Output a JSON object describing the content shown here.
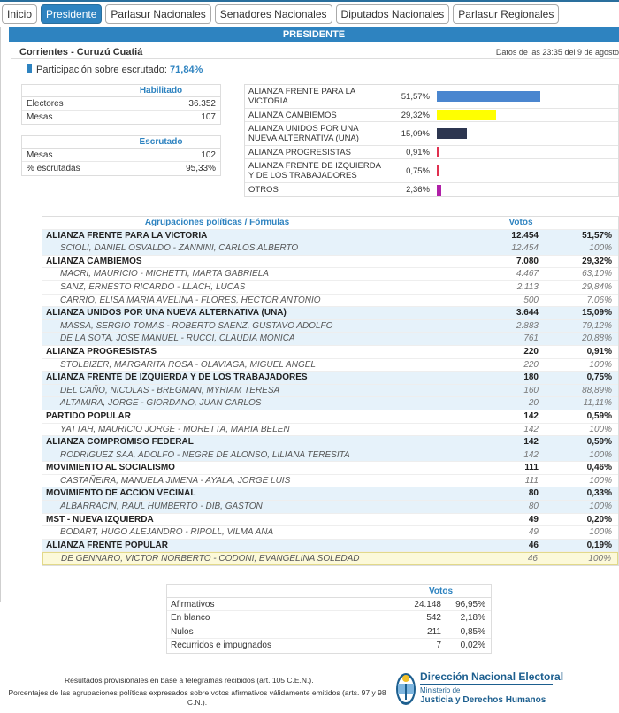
{
  "nav": {
    "tabs": [
      {
        "label": "Inicio",
        "active": false
      },
      {
        "label": "Presidente",
        "active": true
      },
      {
        "label": "Parlasur Nacionales",
        "active": false
      },
      {
        "label": "Senadores Nacionales",
        "active": false
      },
      {
        "label": "Diputados Nacionales",
        "active": false
      },
      {
        "label": "Parlasur Regionales",
        "active": false
      }
    ]
  },
  "section_title": "PRESIDENTE",
  "location": "Corrientes - Curuzú Cuatiá",
  "timestamp": "Datos de las 23:35 del 9 de agosto",
  "participacion": {
    "label": "Participación sobre escrutado:",
    "value": "71,84%"
  },
  "habilitado": {
    "title": "Habilitado",
    "rows": [
      {
        "label": "Electores",
        "value": "36.352"
      },
      {
        "label": "Mesas",
        "value": "107"
      }
    ]
  },
  "escrutado": {
    "title": "Escrutado",
    "rows": [
      {
        "label": "Mesas",
        "value": "102"
      },
      {
        "label": "% escrutadas",
        "value": "95,33%"
      }
    ]
  },
  "bar_chart": [
    {
      "name": "ALIANZA FRENTE PARA LA VICTORIA",
      "pct": "51,57%",
      "value": 51.57,
      "color": "#4a86cf"
    },
    {
      "name": "ALIANZA CAMBIEMOS",
      "pct": "29,32%",
      "value": 29.32,
      "color": "#ffff00"
    },
    {
      "name": "ALIANZA UNIDOS POR UNA NUEVA ALTERNATIVA (UNA)",
      "pct": "15,09%",
      "value": 15.09,
      "color": "#2d3650"
    },
    {
      "name": "ALIANZA PROGRESISTAS",
      "pct": "0,91%",
      "value": 0.91,
      "color": "#e0304f"
    },
    {
      "name": "ALIANZA FRENTE DE IZQUIERDA Y DE LOS TRABAJADORES",
      "pct": "0,75%",
      "value": 0.75,
      "color": "#e0304f"
    },
    {
      "name": "OTROS",
      "pct": "2,36%",
      "value": 2.36,
      "color": "#b020a8"
    }
  ],
  "table": {
    "header": {
      "col1": "Agrupaciones políticas / Fórmulas",
      "col2": "Votos"
    },
    "rows": [
      {
        "kind": "party",
        "blue": true,
        "name": "ALIANZA FRENTE PARA LA VICTORIA",
        "votes": "12.454",
        "pct": "51,57%"
      },
      {
        "kind": "cand",
        "blue": true,
        "name": "SCIOLI, DANIEL OSVALDO - ZANNINI, CARLOS ALBERTO",
        "votes": "12.454",
        "pct": "100%"
      },
      {
        "kind": "party",
        "blue": false,
        "name": "ALIANZA CAMBIEMOS",
        "votes": "7.080",
        "pct": "29,32%"
      },
      {
        "kind": "cand",
        "blue": false,
        "name": "MACRI, MAURICIO - MICHETTI, MARTA GABRIELA",
        "votes": "4.467",
        "pct": "63,10%"
      },
      {
        "kind": "cand",
        "blue": false,
        "name": "SANZ, ERNESTO RICARDO - LLACH, LUCAS",
        "votes": "2.113",
        "pct": "29,84%"
      },
      {
        "kind": "cand",
        "blue": false,
        "name": "CARRIO, ELISA MARIA AVELINA - FLORES, HECTOR ANTONIO",
        "votes": "500",
        "pct": "7,06%"
      },
      {
        "kind": "party",
        "blue": true,
        "name": "ALIANZA UNIDOS POR UNA NUEVA ALTERNATIVA (UNA)",
        "votes": "3.644",
        "pct": "15,09%"
      },
      {
        "kind": "cand",
        "blue": true,
        "name": "MASSA, SERGIO TOMAS - ROBERTO SAENZ, GUSTAVO ADOLFO",
        "votes": "2.883",
        "pct": "79,12%"
      },
      {
        "kind": "cand",
        "blue": true,
        "name": "DE LA SOTA, JOSE MANUEL - RUCCI, CLAUDIA MONICA",
        "votes": "761",
        "pct": "20,88%"
      },
      {
        "kind": "party",
        "blue": false,
        "name": "ALIANZA PROGRESISTAS",
        "votes": "220",
        "pct": "0,91%"
      },
      {
        "kind": "cand",
        "blue": false,
        "name": "STOLBIZER, MARGARITA ROSA - OLAVIAGA, MIGUEL ANGEL",
        "votes": "220",
        "pct": "100%"
      },
      {
        "kind": "party",
        "blue": true,
        "name": "ALIANZA FRENTE DE IZQUIERDA Y DE LOS TRABAJADORES",
        "votes": "180",
        "pct": "0,75%"
      },
      {
        "kind": "cand",
        "blue": true,
        "name": "DEL CAÑO, NICOLAS - BREGMAN, MYRIAM TERESA",
        "votes": "160",
        "pct": "88,89%"
      },
      {
        "kind": "cand",
        "blue": true,
        "name": "ALTAMIRA, JORGE - GIORDANO, JUAN CARLOS",
        "votes": "20",
        "pct": "11,11%"
      },
      {
        "kind": "party",
        "blue": false,
        "name": "PARTIDO POPULAR",
        "votes": "142",
        "pct": "0,59%"
      },
      {
        "kind": "cand",
        "blue": false,
        "name": "YATTAH, MAURICIO JORGE - MORETTA, MARIA BELEN",
        "votes": "142",
        "pct": "100%"
      },
      {
        "kind": "party",
        "blue": true,
        "name": "ALIANZA COMPROMISO FEDERAL",
        "votes": "142",
        "pct": "0,59%"
      },
      {
        "kind": "cand",
        "blue": true,
        "name": "RODRIGUEZ SAA, ADOLFO - NEGRE DE ALONSO, LILIANA TERESITA",
        "votes": "142",
        "pct": "100%"
      },
      {
        "kind": "party",
        "blue": false,
        "name": "MOVIMIENTO AL SOCIALISMO",
        "votes": "111",
        "pct": "0,46%"
      },
      {
        "kind": "cand",
        "blue": false,
        "name": "CASTAÑEIRA, MANUELA JIMENA - AYALA, JORGE LUIS",
        "votes": "111",
        "pct": "100%"
      },
      {
        "kind": "party",
        "blue": true,
        "name": "MOVIMIENTO DE ACCION VECINAL",
        "votes": "80",
        "pct": "0,33%"
      },
      {
        "kind": "cand",
        "blue": true,
        "name": "ALBARRACIN, RAUL HUMBERTO - DIB, GASTON",
        "votes": "80",
        "pct": "100%"
      },
      {
        "kind": "party",
        "blue": false,
        "name": "MST - NUEVA IZQUIERDA",
        "votes": "49",
        "pct": "0,20%"
      },
      {
        "kind": "cand",
        "blue": false,
        "name": "BODART, HUGO ALEJANDRO - RIPOLL, VILMA ANA",
        "votes": "49",
        "pct": "100%"
      },
      {
        "kind": "party",
        "blue": true,
        "name": "ALIANZA FRENTE POPULAR",
        "votes": "46",
        "pct": "0,19%"
      },
      {
        "kind": "cand",
        "blue": false,
        "hl": true,
        "name": "DE GENNARO, VICTOR NORBERTO - CODONI, EVANGELINA SOLEDAD",
        "votes": "46",
        "pct": "100%"
      }
    ]
  },
  "votos": {
    "title": "Votos",
    "rows": [
      {
        "label": "Afirmativos",
        "votes": "24.148",
        "pct": "96,95%"
      },
      {
        "label": "En blanco",
        "votes": "542",
        "pct": "2,18%"
      },
      {
        "label": "Nulos",
        "votes": "211",
        "pct": "0,85%"
      },
      {
        "label": "Recurridos e impugnados",
        "votes": "7",
        "pct": "0,02%"
      }
    ]
  },
  "footer": {
    "line1": "Resultados provisionales en base a telegramas recibidos (art. 105 C.E.N.).",
    "line2": "Porcentajes de las agrupaciones políticas expresados sobre votos afirmativos válidamente emitidos (arts. 97 y 98 C.N.)."
  },
  "logo": {
    "title": "Dirección Nacional Electoral",
    "ministry_line1": "Ministerio de",
    "ministry_line2": "Justicia y Derechos Humanos"
  }
}
